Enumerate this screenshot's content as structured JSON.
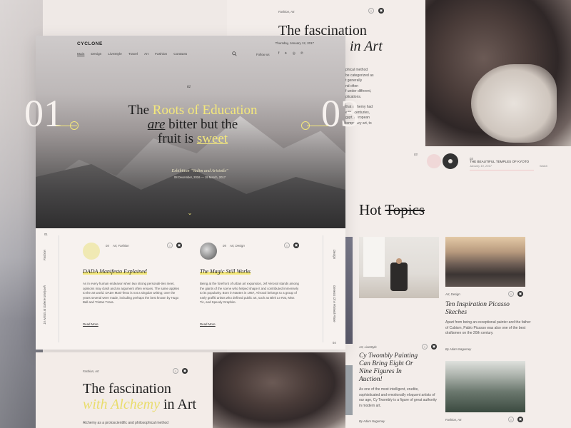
{
  "app": {
    "logo": "CYCLONE",
    "date": "Thursday, January 12, 2017",
    "menu": [
      "Main",
      "Design",
      "LiveStyle",
      "Travel",
      "Art",
      "Fashion",
      "Contacts"
    ],
    "follow_label": "Follow us",
    "social_icons": [
      "facebook-icon",
      "twitter-icon",
      "instagram-icon",
      "pinterest-icon"
    ]
  },
  "hero": {
    "number": "02",
    "headline": {
      "part1": "The ",
      "part2": "Roots of Education",
      "part3": "are",
      "part4": " bitter but the",
      "part5": "fruit is ",
      "part6": "sweet"
    },
    "exhibition": "Exhibition \"Vadim and Aristotle\"",
    "dates": "08 December, 2016 — 19 March, 2017",
    "big_left": "01",
    "big_right": "03"
  },
  "side": {
    "left_top": "01",
    "left_cat": "Fashion",
    "left_caption": "15 Artists at Galerie Marlyseh",
    "right_cat": "Design",
    "right_caption": "Genesis Of A Plained Plane",
    "right_bottom": "04"
  },
  "articles": [
    {
      "num": "04",
      "category": "Art, Fashion",
      "title": "DADA Manifesto Explained",
      "body": "As in every human endeavor when two strong personali-ties meet, opinions may clash and an argument often ensues. The same applies to the art world. DADA Mani-festo is not a singular writing; over the years several were made, including perhaps the best known by Hugo Ball and Tristan Tzara.",
      "more": "Read More"
    },
    {
      "num": "05",
      "category": "Art, Design",
      "title": "The Magic Still Works",
      "body": "Being at the forefront of urban art expansion, Jef Aérosol stands among the giants of the scene who helped shape it and contributed immensely to its popularity. Born in Nantes in 1957, Aérosol belongs to a group of early graffiti artists who defined public art, such as Blek Le Rat, Miss Tic, and Speedy Graphito.",
      "more": "Read More"
    }
  ],
  "lower_feature": {
    "category": "Fashion, Art",
    "title_part1": "The fascination",
    "title_part2": "with Alchemy",
    "title_part3": " in Art",
    "body": "Alchemy as a protoscientific and philosophical method"
  },
  "right_feature": {
    "category": "Fashion, Art",
    "title_part1": "The fascination",
    "title_part2": "in Art",
    "body_lines": [
      "phical method",
      "be categorized as",
      "t generally",
      "nd often",
      "f under different,",
      "plications.",
      "",
      "that alchemy had",
      "e the centuries,",
      "gypt, European",
      "temporary art, to"
    ],
    "page_num": "03"
  },
  "kyoto": {
    "num": "03",
    "title": "THE BEAUTIFUL TEMPLES OF KYOTO",
    "date": "January 10, 2017",
    "read": "Watch"
  },
  "hot": {
    "word1": "Hot ",
    "word2": "Topics"
  },
  "hot_articles": [
    {
      "category": "Art, Design",
      "title": "Ten Inspiration Picasso Skeches",
      "body": "Apart from being an exceptional painter and the father of Cubism, Pablo Picasso was also one of the best draftsmen on the 20th century.",
      "author": "By Adam Nagurney"
    },
    {
      "category": "Art, LiveStyle",
      "title": "Cy Twombly Painting Can Bring Eight Or Nine Figures In Auction!",
      "body": "As one of the most intelligent, erudite, sophisticated and emotionally eloquent artists of our age, Cy Twombly is a figure of great authority in modern art.",
      "author": "By Adam Nagurney"
    },
    {
      "category": "Fashion, Art"
    }
  ],
  "colors": {
    "accent_yellow": "#f4e87b",
    "text_dark": "#1e1e1e",
    "bg_cream": "#f7f2ef"
  }
}
